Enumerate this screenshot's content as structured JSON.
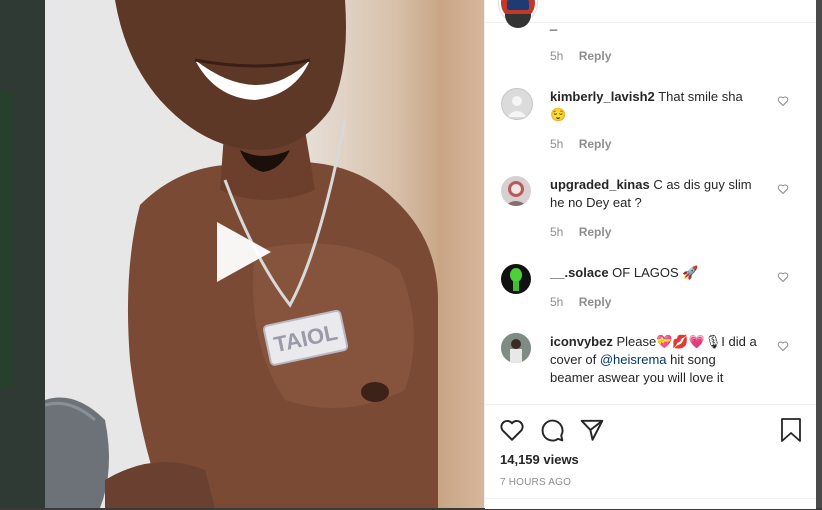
{
  "post": {
    "views": "14,159 views",
    "time_ago": "7 HOURS AGO"
  },
  "partial_comment": {
    "text": "_",
    "time": "5h",
    "reply": "Reply"
  },
  "comments": [
    {
      "username": "kimberly_lavish2",
      "text": "That smile sha 😌",
      "time": "5h",
      "reply": "Reply"
    },
    {
      "username": "upgraded_kinas",
      "text": "C as dis guy slim he no Dey eat ?",
      "time": "5h",
      "reply": "Reply"
    },
    {
      "username": "__.solace",
      "text": "OF LAGOS 🚀",
      "time": "5h",
      "reply": "Reply"
    },
    {
      "username": "iconvybez",
      "text_before": "Please💝💋💗🎙I did a cover of ",
      "mention": "@heisrema",
      "text_after": " hit song beamer aswear you will love it"
    }
  ],
  "video": {
    "pendant_text": "TAIOL"
  },
  "icons": {
    "play": "play-icon",
    "like": "heart-outline-icon",
    "comment": "comment-icon",
    "share": "paper-plane-icon",
    "save": "bookmark-icon",
    "comment_like": "small-heart-icon"
  },
  "colors": {
    "text": "#262626",
    "secondary": "#8e8e8e",
    "mention": "#00376b",
    "border": "#efefef"
  }
}
